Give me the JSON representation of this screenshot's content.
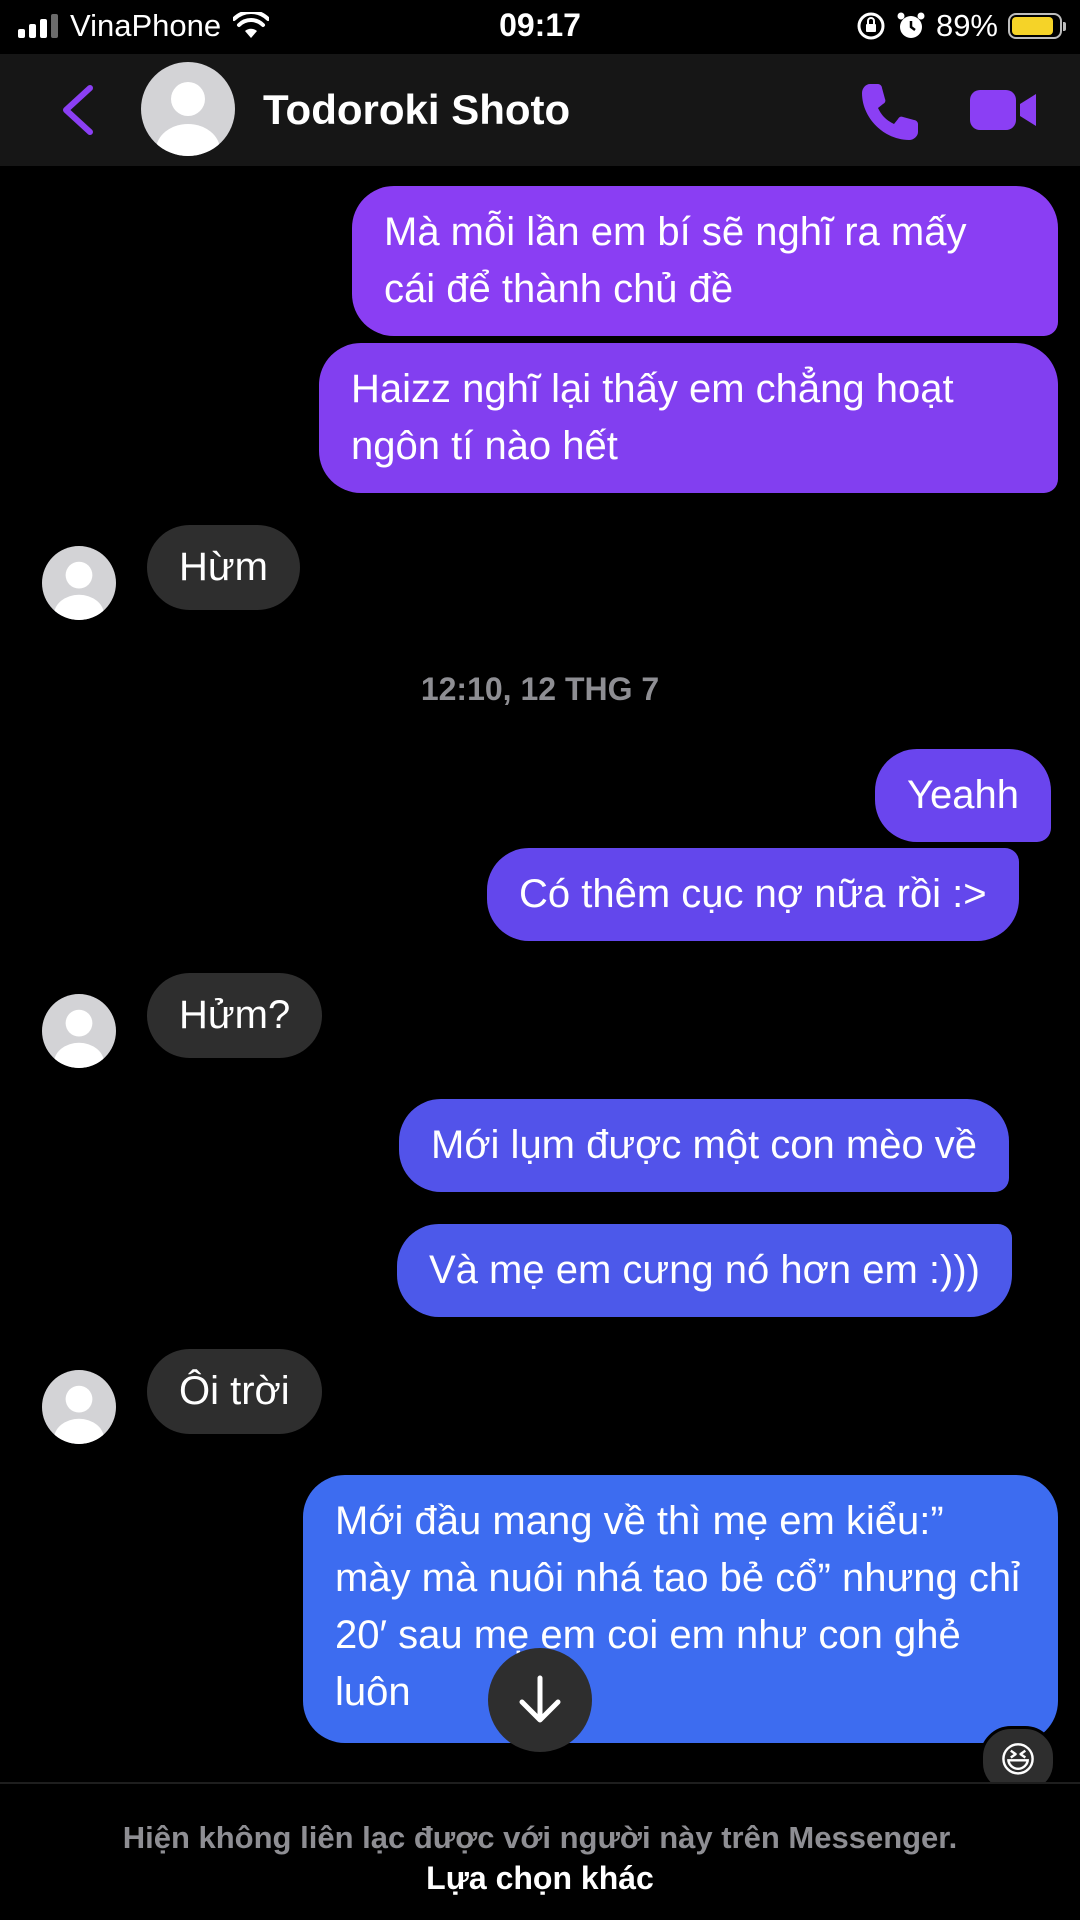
{
  "status_bar": {
    "carrier": "VinaPhone",
    "time": "09:17",
    "battery_percent": "89%",
    "battery_level": 0.89,
    "battery_color": "#f5d328",
    "icons": [
      "signal-icon",
      "wifi-icon",
      "rotation-lock-icon",
      "alarm-icon",
      "battery-icon"
    ]
  },
  "header": {
    "back_icon": "chevron-left-icon",
    "contact_name": "Todoroki Shoto",
    "call_icon": "phone-icon",
    "video_icon": "video-camera-icon",
    "accent_color": "#8b3ff4"
  },
  "messages": [
    {
      "side": "out",
      "text": "Mà mỗi lần em bí sẽ nghĩ ra mấy cái để thành chủ đề",
      "color": "#8a3ef3"
    },
    {
      "side": "out",
      "text": "Haizz nghĩ lại thấy em chẳng hoạt ngôn tí nào hết",
      "color": "#823ff0"
    },
    {
      "side": "in",
      "text": "Hừm"
    },
    {
      "timestamp": "12:10, 12 THG 7"
    },
    {
      "side": "out",
      "text": "Yeahh",
      "color": "#6a45ee"
    },
    {
      "side": "out",
      "text": "Có thêm cục nợ nữa rồi :>",
      "color": "#6347ec"
    },
    {
      "side": "in",
      "text": "Hửm?"
    },
    {
      "side": "out",
      "text": "Mới lụm được một con mèo về",
      "color": "#5253ea"
    },
    {
      "side": "out",
      "text": "Và mẹ em cưng nó hơn em :)))",
      "color": "#4c59ea"
    },
    {
      "side": "in",
      "text": "Ôi trời"
    },
    {
      "side": "out",
      "text": "Mới đầu mang về thì mẹ em kiểu:” mày mà nuôi nhá tao bẻ cổ” nhưng chỉ 20′ sau mẹ em coi em như con ghẻ luôn",
      "color": "#3d6cf0"
    }
  ],
  "reaction": {
    "emoji": "😆"
  },
  "scroll_button": {
    "icon": "arrow-down-icon"
  },
  "footer": {
    "notice": "Hiện không liên lạc được với người này trên Messenger.",
    "link": "Lựa chọn khác"
  }
}
